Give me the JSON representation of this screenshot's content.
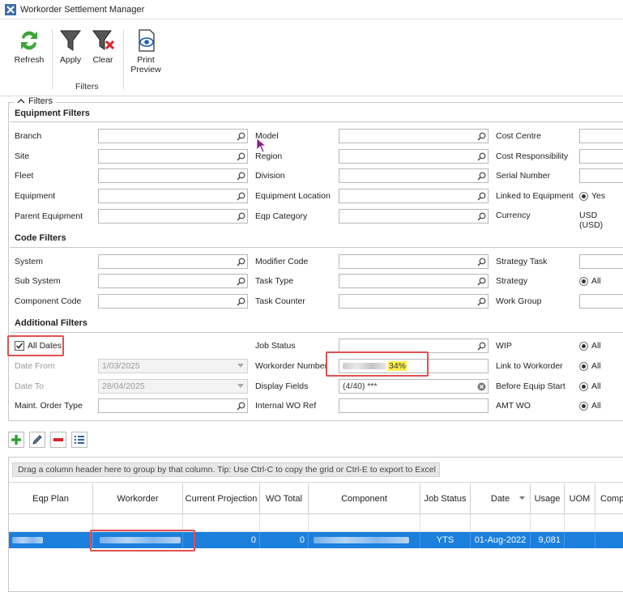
{
  "window": {
    "title": "Workorder Settlement Manager"
  },
  "ribbon": {
    "refresh": "Refresh",
    "apply": "Apply",
    "clear": "Clear",
    "filters_group": "Filters",
    "print_preview_line1": "Print",
    "print_preview_line2": "Preview"
  },
  "panel": {
    "title": "Filters"
  },
  "equipment": {
    "title": "Equipment Filters",
    "branch": "Branch",
    "site": "Site",
    "fleet": "Fleet",
    "equipment": "Equipment",
    "parent_equipment": "Parent Equipment",
    "model": "Model",
    "region": "Region",
    "division": "Division",
    "equipment_location": "Equipment Location",
    "eqp_category": "Eqp Category",
    "cost_centre": "Cost Centre",
    "cost_responsibility": "Cost Responsibility",
    "serial_number": "Serial Number",
    "linked_to_equipment": "Linked to Equipment",
    "linked_value": "Yes",
    "currency": "Currency",
    "currency_value": "USD (USD)"
  },
  "code": {
    "title": "Code Filters",
    "system": "System",
    "sub_system": "Sub System",
    "component_code": "Component Code",
    "modifier_code": "Modifier Code",
    "task_type": "Task Type",
    "task_counter": "Task Counter",
    "strategy_task": "Strategy Task",
    "strategy": "Strategy",
    "strategy_value": "All",
    "work_group": "Work Group"
  },
  "additional": {
    "title": "Additional Filters",
    "all_dates": "All Dates",
    "date_from": "Date From",
    "date_from_value": "1/03/2025",
    "date_to": "Date To",
    "date_to_value": "28/04/2025",
    "maint_order_type": "Maint. Order Type",
    "job_status": "Job Status",
    "workorder_number": "Workorder Number",
    "workorder_number_suffix": "34%",
    "display_fields": "Display Fields",
    "display_fields_value": "(4/40) ***",
    "internal_wo_ref": "Internal WO Ref",
    "wip": "WIP",
    "wip_value": "All",
    "link_to_workorder": "Link to Workorder",
    "link_value": "All",
    "before_equip_start": "Before Equip Start",
    "before_value": "All",
    "amt_wo": "AMT WO",
    "amt_value": "All"
  },
  "grid": {
    "group_hint": "Drag a column header here to group by that column. Tip: Use Ctrl-C to copy the grid or Ctrl-E to export to Excel",
    "columns": [
      "Eqp Plan",
      "Workorder",
      "Current Projection",
      "WO Total",
      "Component",
      "Job Status",
      "Date",
      "Usage",
      "UOM",
      "Comp"
    ],
    "row": {
      "current_projection": "0",
      "wo_total": "0",
      "job_status": "YTS",
      "date": "01-Aug-2022",
      "usage": "9,081"
    }
  }
}
